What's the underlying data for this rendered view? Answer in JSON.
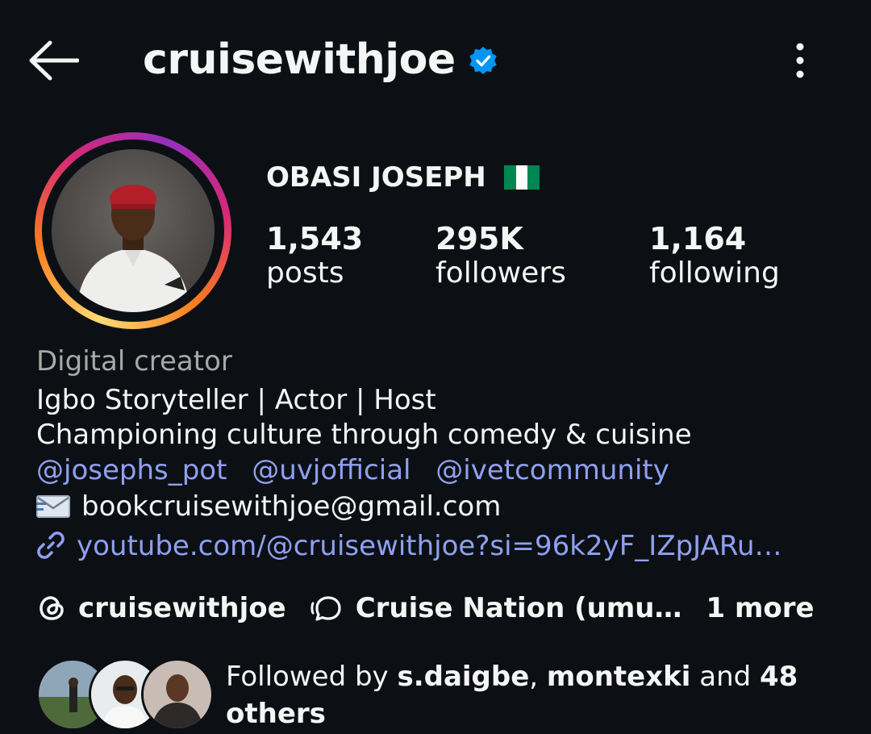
{
  "header": {
    "username": "cruisewithjoe"
  },
  "profile": {
    "full_name": "OBASI JOSEPH",
    "stats": [
      {
        "value": "1,543",
        "label": "posts"
      },
      {
        "value": "295K",
        "label": "followers"
      },
      {
        "value": "1,164",
        "label": "following"
      }
    ]
  },
  "bio": {
    "category": "Digital creator",
    "line1": "Igbo Storyteller | Actor | Host",
    "line2": "Championing culture through comedy & cuisine",
    "mentions": [
      "@josephs_pot",
      "@uvjofficial",
      "@ivetcommunity"
    ],
    "email": "bookcruisewithjoe@gmail.com",
    "link": "youtube.com/@cruisewithjoe?si=96k2yF_IZpJARu…"
  },
  "chips": {
    "threads": "cruisewithjoe",
    "channel": "Cruise Nation (umu…",
    "more": "1 more"
  },
  "followed_by": {
    "prefix": "Followed by ",
    "user1": "s.daigbe",
    "sep": ", ",
    "user2": "montexki",
    "and": " and ",
    "count": "48",
    "suffix": "others"
  },
  "colors": {
    "background": "#0c1014",
    "link": "#8fa0f0",
    "verified": "#0095f6",
    "muted": "#a8a8a8"
  }
}
